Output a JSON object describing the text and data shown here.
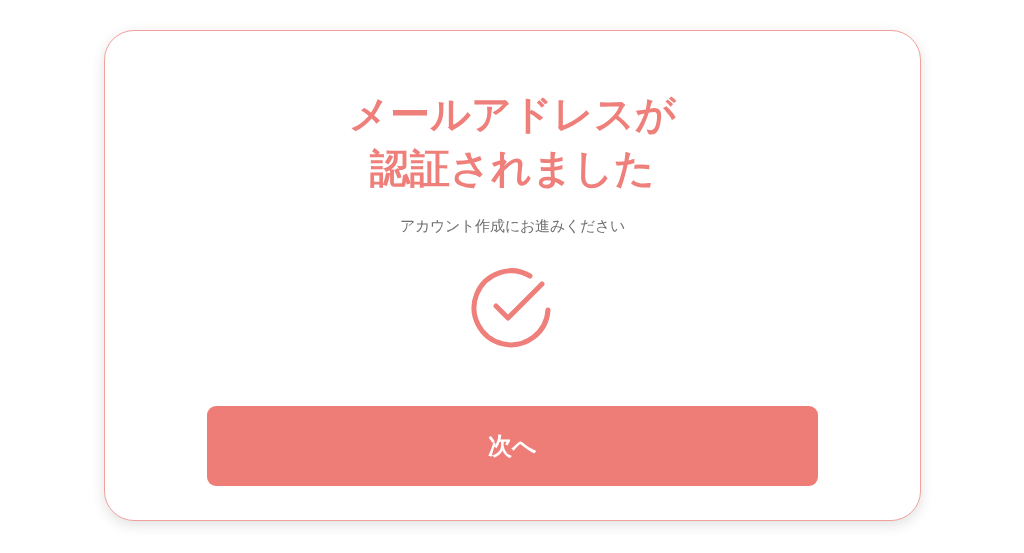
{
  "card": {
    "title_lines": [
      "メールアドレスが",
      "認証されました"
    ],
    "subtitle": "アカウント作成にお進みください",
    "button": "次へ"
  }
}
